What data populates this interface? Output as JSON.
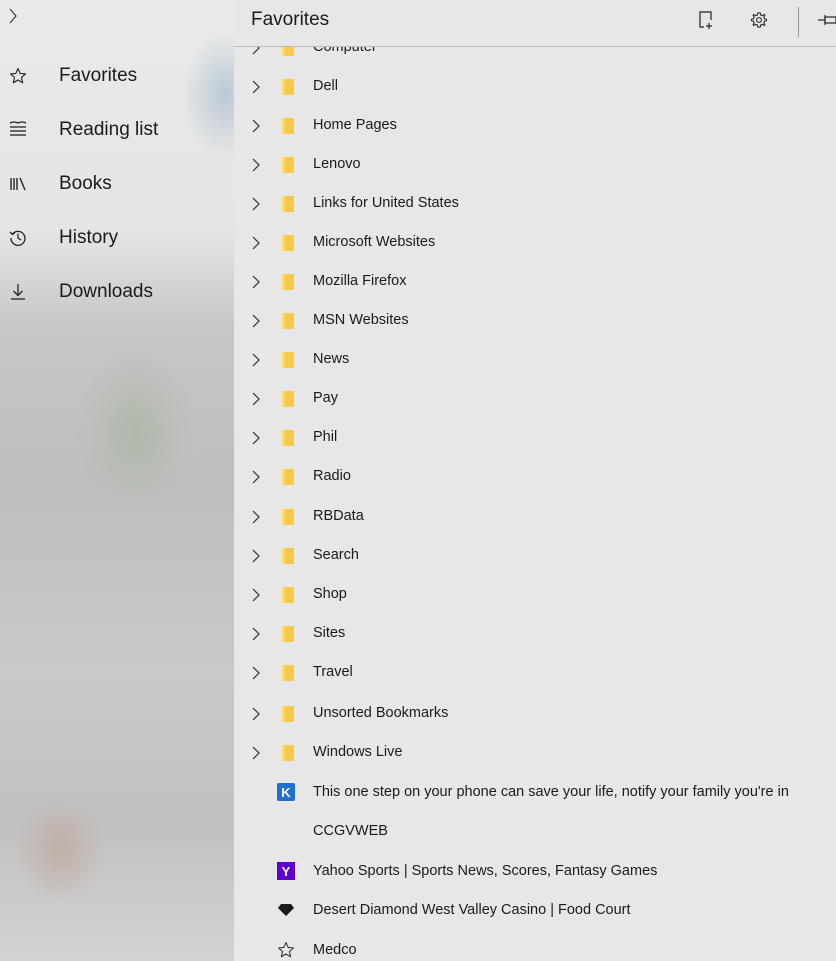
{
  "nav": {
    "items": [
      {
        "label": "Favorites",
        "icon": "star-outline-icon"
      },
      {
        "label": "Reading list",
        "icon": "reading-list-icon"
      },
      {
        "label": "Books",
        "icon": "books-icon"
      },
      {
        "label": "History",
        "icon": "history-icon"
      },
      {
        "label": "Downloads",
        "icon": "download-icon"
      }
    ]
  },
  "header": {
    "title": "Favorites"
  },
  "folders": [
    {
      "label": "Computer"
    },
    {
      "label": "Dell"
    },
    {
      "label": "Home Pages"
    },
    {
      "label": "Lenovo"
    },
    {
      "label": "Links for United States"
    },
    {
      "label": "Microsoft Websites"
    },
    {
      "label": "Mozilla Firefox"
    },
    {
      "label": "MSN Websites"
    },
    {
      "label": "News"
    },
    {
      "label": "Pay"
    },
    {
      "label": "Phil"
    },
    {
      "label": "Radio"
    },
    {
      "label": "RBData"
    },
    {
      "label": "Search"
    },
    {
      "label": "Shop"
    },
    {
      "label": "Sites"
    },
    {
      "label": "Travel"
    },
    {
      "label": "Unsorted Bookmarks"
    },
    {
      "label": "Windows Live"
    }
  ],
  "links": [
    {
      "label": "This one step on your phone can save your life, notify your family you're in",
      "icon": "k-favicon",
      "icon_text": "K",
      "icon_color": "#1e6fd0"
    },
    {
      "label": "CCGVWEB",
      "icon": "none"
    },
    {
      "label": "Yahoo Sports | Sports News, Scores, Fantasy Games",
      "icon": "yahoo-favicon",
      "icon_text": "Y",
      "icon_color": "#5f01d1"
    },
    {
      "label": "Desert Diamond West Valley Casino | Food Court",
      "icon": "diamond-favicon",
      "icon_color": "#1a1a1a"
    },
    {
      "label": "Medco",
      "icon": "star-outline-icon"
    }
  ],
  "colors": {
    "folder": "#f7c948",
    "background": "#e7e7e7"
  }
}
